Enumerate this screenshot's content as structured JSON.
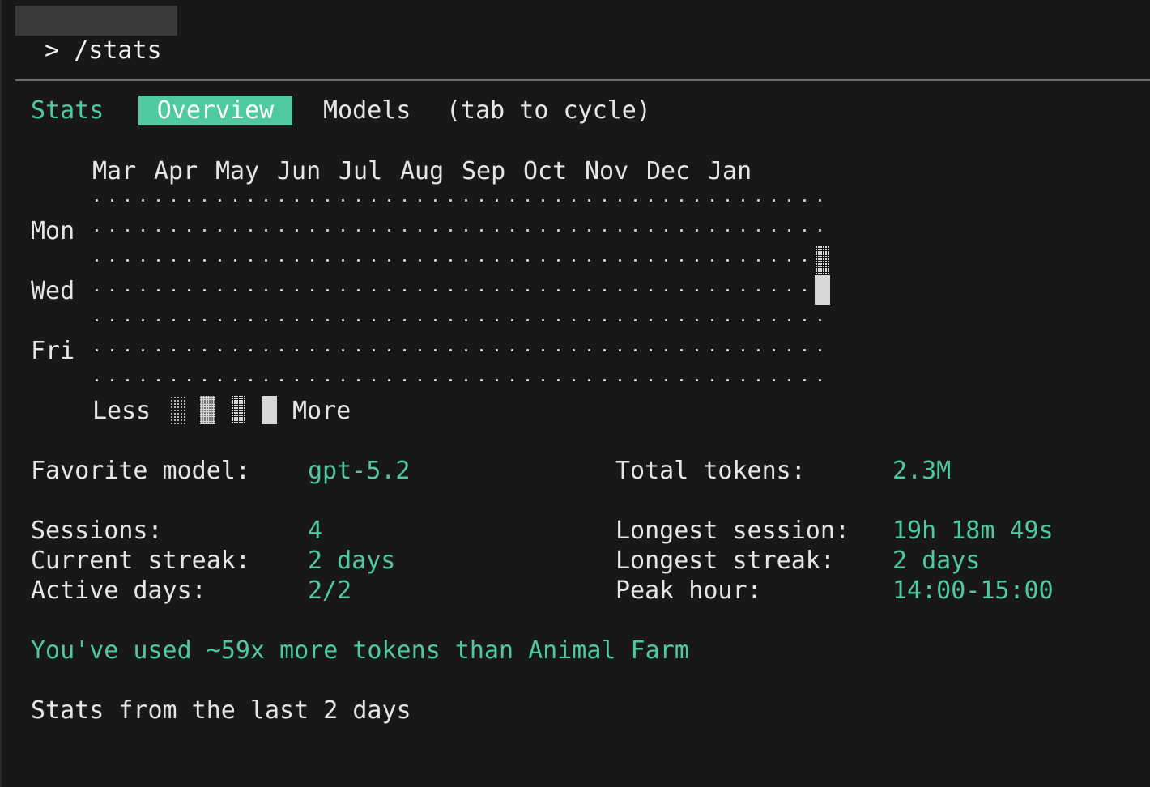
{
  "prompt": {
    "text": "> /stats"
  },
  "tabs": [
    {
      "label": "Stats"
    },
    {
      "label": "Overview"
    },
    {
      "label": "Models"
    },
    {
      "label": "(tab to cycle)"
    }
  ],
  "heatmap": {
    "months": [
      "Mar",
      "Apr",
      "May",
      "Jun",
      "Jul",
      "Aug",
      "Sep",
      "Oct",
      "Nov",
      "Dec",
      "Jan"
    ],
    "day_labels": {
      "mon": "Mon",
      "wed": "Wed",
      "fri": "Fri"
    },
    "legend": {
      "less": "Less",
      "more": "More",
      "levels": 4
    },
    "colors": {
      "active": "#4ec9a0",
      "cell": "#d8d8d8"
    }
  },
  "stats": {
    "favorite_model": {
      "label": "Favorite model:",
      "value": "gpt-5.2"
    },
    "total_tokens": {
      "label": "Total tokens:",
      "value": "2.3M"
    },
    "sessions": {
      "label": "Sessions:",
      "value": "4"
    },
    "longest_session": {
      "label": "Longest session:",
      "value": "19h 18m 49s"
    },
    "current_streak": {
      "label": "Current streak:",
      "value": "2 days"
    },
    "longest_streak": {
      "label": "Longest streak:",
      "value": "2 days"
    },
    "active_days": {
      "label": "Active days:",
      "value": "2/2"
    },
    "peak_hour": {
      "label": "Peak hour:",
      "value": "14:00-15:00"
    }
  },
  "fun_fact": "You've used ~59x more tokens than Animal Farm",
  "footer": "Stats from the last 2 days"
}
